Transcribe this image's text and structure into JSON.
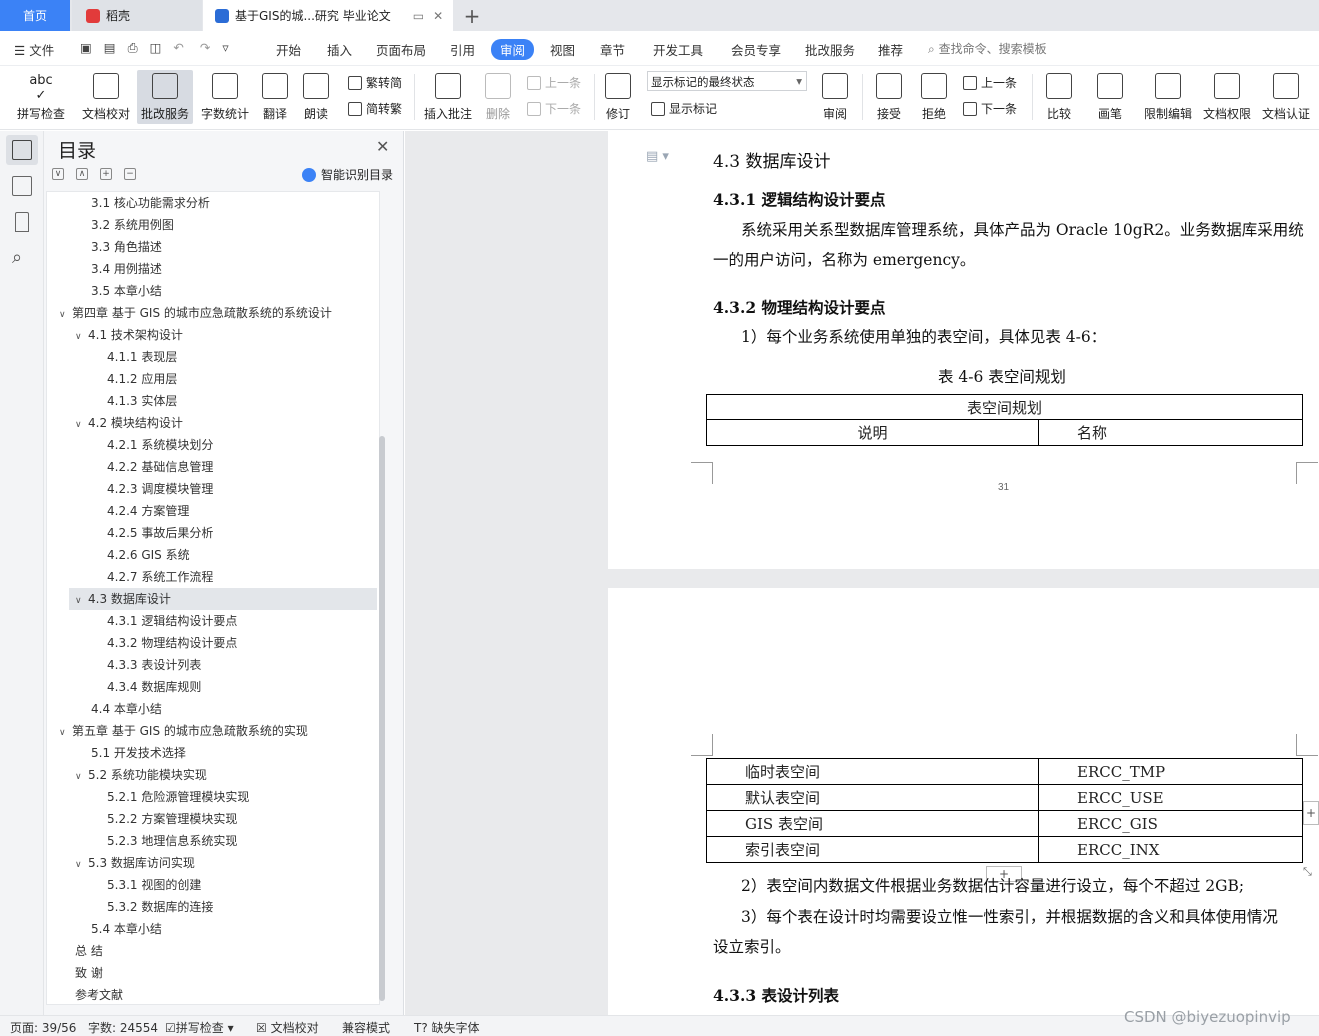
{
  "tabs": {
    "home": "首页",
    "daoke": "稻壳",
    "doc": "基于GIS的城...研究 毕业论文",
    "new_tab": "+"
  },
  "menu": {
    "file": "文件",
    "items": [
      "开始",
      "插入",
      "页面布局",
      "引用",
      "审阅",
      "视图",
      "章节",
      "开发工具",
      "会员专享",
      "批改服务",
      "推荐"
    ],
    "active": "审阅",
    "search": "查找命令、搜索模板"
  },
  "ribbon": {
    "spell": "拼写检查",
    "proof": "文档校对",
    "correction": "批改服务",
    "wordcount": "字数统计",
    "translate": "翻译",
    "read": "朗读",
    "trad": "繁转简",
    "simp": "简转繁",
    "insert_comment": "插入批注",
    "delete": "删除",
    "prev_comment": "上一条",
    "next_comment": "下一条",
    "track": "修订",
    "markup_state": "显示标记的最终状态",
    "show_markup": "显示标记",
    "review": "审阅",
    "accept": "接受",
    "reject": "拒绝",
    "prev": "上一条",
    "next": "下一条",
    "compare": "比较",
    "pen": "画笔",
    "restrict": "限制编辑",
    "permission": "文档权限",
    "certify": "文档认证"
  },
  "toc": {
    "title": "目录",
    "smart": "智能识别目录",
    "items": [
      {
        "label": "3.1  核心功能需求分析",
        "level": 2,
        "tw": ""
      },
      {
        "label": "3.2  系统用例图",
        "level": 2,
        "tw": ""
      },
      {
        "label": "3.3  角色描述",
        "level": 2,
        "tw": ""
      },
      {
        "label": "3.4  用例描述",
        "level": 2,
        "tw": ""
      },
      {
        "label": "3.5  本章小结",
        "level": 2,
        "tw": ""
      },
      {
        "label": "第四章  基于 GIS 的城市应急疏散系统的系统设计",
        "level": 1,
        "tw": "∨"
      },
      {
        "label": "4.1    技术架构设计",
        "level": 2,
        "tw": "∨"
      },
      {
        "label": "4.1.1  表现层",
        "level": 3,
        "tw": ""
      },
      {
        "label": "4.1.2  应用层",
        "level": 3,
        "tw": ""
      },
      {
        "label": "4.1.3  实体层",
        "level": 3,
        "tw": ""
      },
      {
        "label": "4.2  模块结构设计",
        "level": 2,
        "tw": "∨"
      },
      {
        "label": "4.2.1  系统模块划分",
        "level": 3,
        "tw": ""
      },
      {
        "label": "4.2.2  基础信息管理",
        "level": 3,
        "tw": ""
      },
      {
        "label": "4.2.3  调度模块管理",
        "level": 3,
        "tw": ""
      },
      {
        "label": "4.2.4  方案管理",
        "level": 3,
        "tw": ""
      },
      {
        "label": "4.2.5  事故后果分析",
        "level": 3,
        "tw": ""
      },
      {
        "label": "4.2.6 GIS 系统",
        "level": 3,
        "tw": ""
      },
      {
        "label": "4.2.7  系统工作流程",
        "level": 3,
        "tw": ""
      },
      {
        "label": "4.3  数据库设计",
        "level": 2,
        "tw": "∨",
        "selected": true
      },
      {
        "label": "4.3.1  逻辑结构设计要点",
        "level": 3,
        "tw": ""
      },
      {
        "label": "4.3.2  物理结构设计要点",
        "level": 3,
        "tw": ""
      },
      {
        "label": "4.3.3  表设计列表",
        "level": 3,
        "tw": ""
      },
      {
        "label": "4.3.4  数据库规则",
        "level": 3,
        "tw": ""
      },
      {
        "label": "4.4  本章小结",
        "level": 2,
        "tw": ""
      },
      {
        "label": "第五章  基于 GIS 的城市应急疏散系统的实现",
        "level": 1,
        "tw": "∨"
      },
      {
        "label": "5.1  开发技术选择",
        "level": 2,
        "tw": ""
      },
      {
        "label": "5.2  系统功能模块实现",
        "level": 2,
        "tw": "∨"
      },
      {
        "label": "5.2.1  危险源管理模块实现",
        "level": 3,
        "tw": ""
      },
      {
        "label": "5.2.2  方案管理模块实现",
        "level": 3,
        "tw": ""
      },
      {
        "label": "5.2.3  地理信息系统实现",
        "level": 3,
        "tw": ""
      },
      {
        "label": "5.3  数据库访问实现",
        "level": 2,
        "tw": "∨"
      },
      {
        "label": "5.3.1  视图的创建",
        "level": 3,
        "tw": ""
      },
      {
        "label": "5.3.2  数据库的连接",
        "level": 3,
        "tw": ""
      },
      {
        "label": "5.4  本章小结",
        "level": 2,
        "tw": ""
      },
      {
        "label": "总    结",
        "level": 0,
        "tw": ""
      },
      {
        "label": "致    谢",
        "level": 0,
        "tw": ""
      },
      {
        "label": "参考文献",
        "level": 0,
        "tw": ""
      }
    ]
  },
  "doc": {
    "h43": "4.3  数据库设计",
    "h431": "4.3.1  逻辑结构设计要点",
    "p1a": "系统采用关系型数据库管理系统，具体产品为 Oracle 10gR2。业务数据库采用统",
    "p1b": "一的用户访问，名称为 emergency。",
    "h432": "4.3.2  物理结构设计要点",
    "p2": "1）每个业务系统使用单独的表空间，具体见表 4-6：",
    "table_caption": "表 4-6  表空间规划",
    "table_header": "表空间规划",
    "col1": "说明",
    "col2": "名称",
    "page_num": "31",
    "rows": [
      {
        "a": "临时表空间",
        "b": "ERCC_TMP"
      },
      {
        "a": "默认表空间",
        "b": "ERCC_USE"
      },
      {
        "a": "GIS 表空间",
        "b": "ERCC_GIS"
      },
      {
        "a": "索引表空间",
        "b": "ERCC_INX"
      }
    ],
    "p3": "2）表空间内数据文件根据业务数据估计容量进行设立，每个不超过 2GB;",
    "p4a": "3）每个表在设计时均需要设立惟一性索引，并根据数据的含义和具体使用情况",
    "p4b": "设立索引。",
    "h433": "4.3.3  表设计列表"
  },
  "status": {
    "page": "页面: 39/56",
    "words": "字数: 24554",
    "spell": "拼写检查",
    "proof": "文档校对",
    "compat": "兼容模式",
    "missing_font": "缺失字体"
  },
  "watermark": "CSDN @biyezuopinvip",
  "colors": {
    "accent": "#3b82f6",
    "tab_bg": "#e5e7eb",
    "doc_bg": "#e9eaec"
  }
}
